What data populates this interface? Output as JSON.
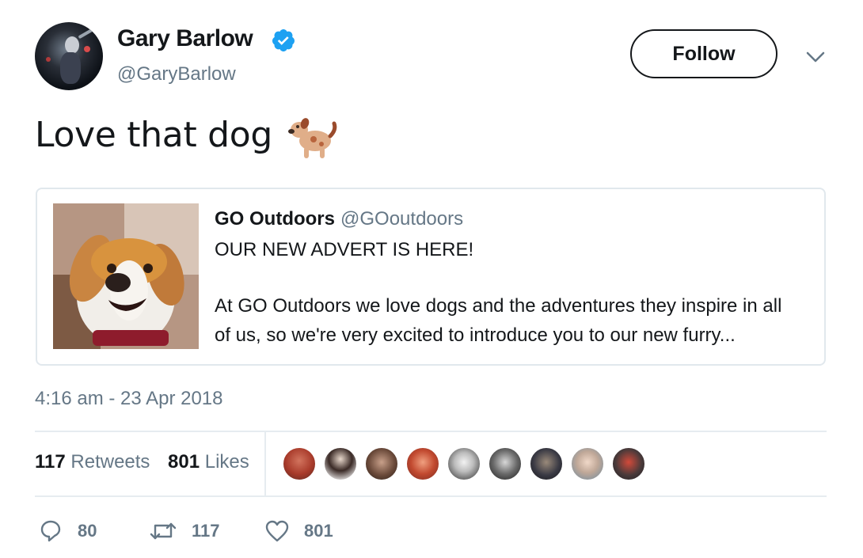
{
  "author": {
    "name": "Gary Barlow",
    "handle": "@GaryBarlow",
    "verified": true,
    "avatar_icon": "profile-photo-singer-on-stage"
  },
  "follow_button": {
    "label": "Follow"
  },
  "menu": {
    "icon": "chevron-down-icon"
  },
  "tweet": {
    "text": "Love that dog",
    "emoji": "dog-emoji"
  },
  "quoted_tweet": {
    "author_name": "GO Outdoors",
    "author_handle": "@GOoutdoors",
    "line1": "OUR NEW ADVERT IS HERE!",
    "line2": "At GO Outdoors we love dogs and the adventures they inspire in all",
    "line3": "of us, so we're very excited to introduce you to our new furry...",
    "image_icon": "beagle-dog-photo"
  },
  "timestamp": "4:16 am - 23 Apr 2018",
  "stats": {
    "retweets_count": "117",
    "retweets_label": "Retweets",
    "likes_count": "801",
    "likes_label": "Likes"
  },
  "likers": [
    "liker-avatar-1",
    "liker-avatar-2",
    "liker-avatar-3",
    "liker-avatar-4",
    "liker-avatar-5",
    "liker-avatar-6",
    "liker-avatar-7",
    "liker-avatar-8",
    "liker-avatar-9"
  ],
  "actions": {
    "reply_count": "80",
    "retweet_count": "117",
    "like_count": "801"
  },
  "colors": {
    "verified_blue": "#1da1f2",
    "secondary_text": "#657786",
    "border": "#e1e8ed"
  }
}
